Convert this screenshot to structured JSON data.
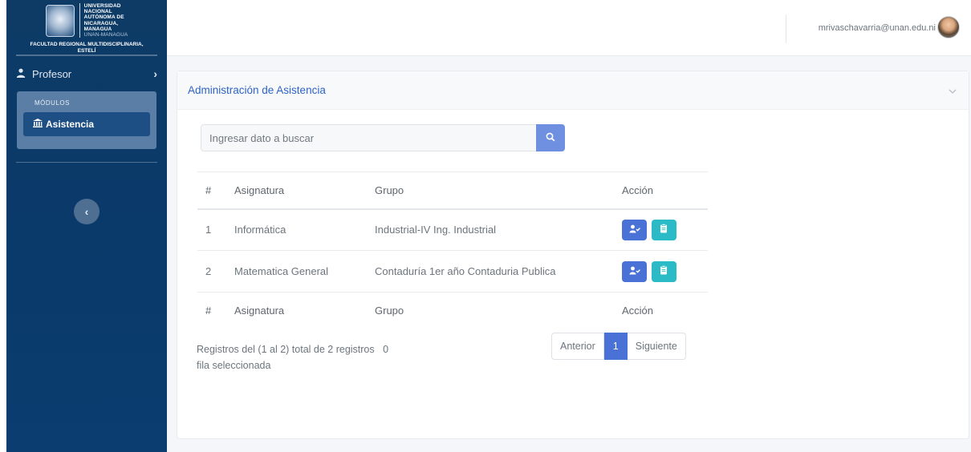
{
  "sidebar": {
    "university_lines": [
      "UNIVERSIDAD",
      "NACIONAL",
      "AUTÓNOMA DE",
      "NICARAGUA,",
      "MANAGUA"
    ],
    "university_sub": "UNAN-MANAGUA",
    "faculty_line1": "FACULTAD REGIONAL MULTIDISCIPLINARIA,",
    "faculty_line2": "ESTELÍ",
    "menu_profesor": "Profesor",
    "modules_title": "MÓDULOS",
    "module_item": "Asistencia",
    "collapse_icon": "chevron-left-icon"
  },
  "topbar": {
    "email": "mrivaschavarria@unan.edu.ni"
  },
  "card": {
    "title": "Administración de Asistencia",
    "search_placeholder": "Ingresar dato a buscar"
  },
  "table": {
    "headers": {
      "num": "#",
      "asignatura": "Asignatura",
      "grupo": "Grupo",
      "accion": "Acción"
    },
    "rows": [
      {
        "num": "1",
        "asignatura": "Informática",
        "grupo": "Industrial-IV Ing. Industrial"
      },
      {
        "num": "2",
        "asignatura": "Matematica General",
        "grupo": "Contaduría 1er año Contaduria Publica"
      }
    ]
  },
  "footer": {
    "records_text": "Registros del (1 al 2) total de 2 registros",
    "selected_text": "0 fila seleccionada"
  },
  "pagination": {
    "prev": "Anterior",
    "current": "1",
    "next": "Siguiente"
  },
  "colors": {
    "sidebar_bg": "#0d3b66",
    "accent_blue": "#4a72d6",
    "accent_teal": "#2bbbc7",
    "title_blue": "#2e63c6"
  }
}
